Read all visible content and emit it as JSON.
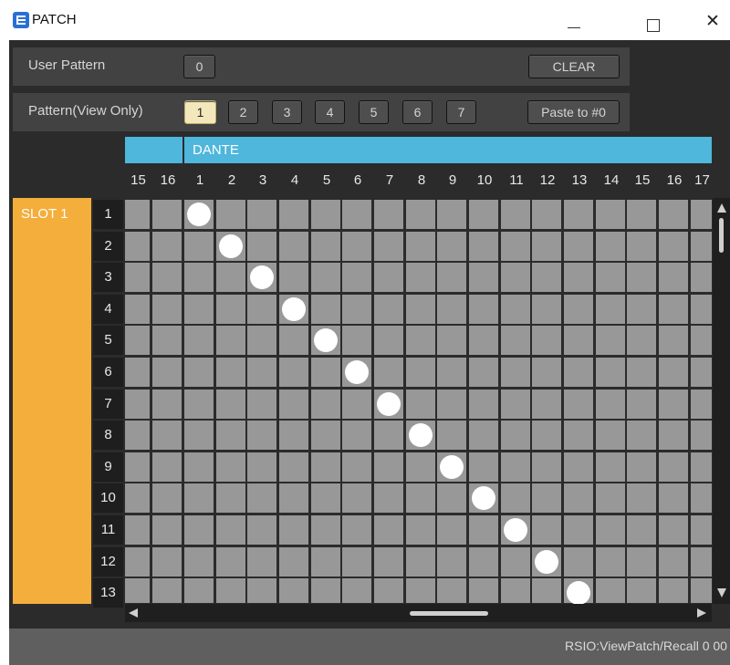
{
  "window": {
    "title": "PATCH",
    "minimize_icon": "minimize-icon",
    "maximize_icon": "maximize-icon",
    "close_glyph": "✕"
  },
  "user_pattern": {
    "label": "User Pattern",
    "value": "0",
    "clear_label": "CLEAR"
  },
  "pattern": {
    "label": "Pattern(View Only)",
    "buttons": [
      "1",
      "2",
      "3",
      "4",
      "5",
      "6",
      "7"
    ],
    "selected": "1",
    "paste_label": "Paste to #0"
  },
  "grid": {
    "group_label": "DANTE",
    "columns": [
      "15",
      "16",
      "1",
      "2",
      "3",
      "4",
      "5",
      "6",
      "7",
      "8",
      "9",
      "10",
      "11",
      "12",
      "13",
      "14",
      "15",
      "16",
      "17"
    ],
    "slot_label": "SLOT 1",
    "rows": [
      "1",
      "2",
      "3",
      "4",
      "5",
      "6",
      "7",
      "8",
      "9",
      "10",
      "11",
      "12",
      "13"
    ],
    "patches": [
      {
        "row": "1",
        "col": "1"
      },
      {
        "row": "2",
        "col": "2"
      },
      {
        "row": "3",
        "col": "3"
      },
      {
        "row": "4",
        "col": "4"
      },
      {
        "row": "5",
        "col": "5"
      },
      {
        "row": "6",
        "col": "6"
      },
      {
        "row": "7",
        "col": "7"
      },
      {
        "row": "8",
        "col": "8"
      },
      {
        "row": "9",
        "col": "9"
      },
      {
        "row": "10",
        "col": "10"
      },
      {
        "row": "11",
        "col": "11"
      },
      {
        "row": "12",
        "col": "12"
      },
      {
        "row": "13",
        "col": "13"
      }
    ]
  },
  "status": {
    "text": "RSIO:ViewPatch/Recall 0 00"
  },
  "colors": {
    "frame": "#2b2b2b",
    "dante_accent": "#4fb6dc",
    "slot_accent": "#f4ae3b",
    "cell": "#989898",
    "selected_button": "#f3e8bb",
    "patch_dot": "#ffffff"
  }
}
